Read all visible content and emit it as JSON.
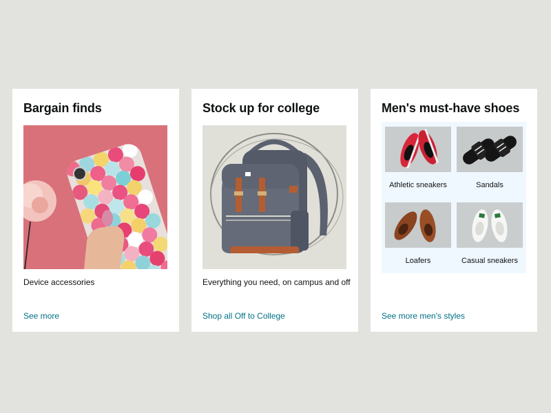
{
  "cards": [
    {
      "title": "Bargain finds",
      "caption": "Device accessories",
      "link": "See more"
    },
    {
      "title": "Stock up for college",
      "caption": "Everything you need, on campus and off",
      "link": "Shop all Off to College"
    },
    {
      "title": "Men's must-have shoes",
      "link": "See more men's styles",
      "items": [
        {
          "label": "Athletic sneakers"
        },
        {
          "label": "Sandals"
        },
        {
          "label": "Loafers"
        },
        {
          "label": "Casual sneakers"
        }
      ]
    }
  ],
  "colors": {
    "page_background": "#e2e3df",
    "card_background": "#ffffff",
    "link": "#007185",
    "text": "#0f1111",
    "tile_background": "#f0f8ff"
  }
}
